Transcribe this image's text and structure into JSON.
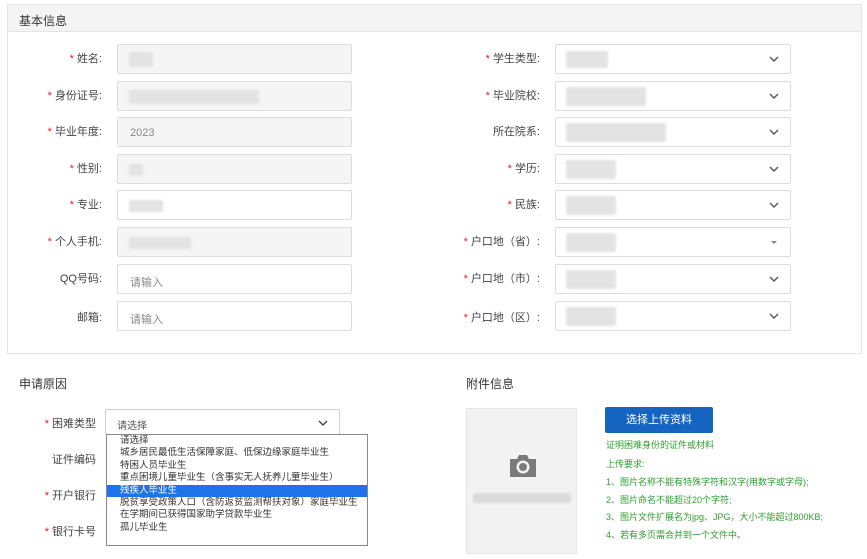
{
  "basic": {
    "title": "基本信息",
    "left_fields": [
      {
        "label": "姓名:",
        "required": true,
        "value": "",
        "placeholder": "",
        "disabled": true
      },
      {
        "label": "身份证号:",
        "required": true,
        "value": "",
        "placeholder": "",
        "disabled": true
      },
      {
        "label": "毕业年度:",
        "required": true,
        "value": "2023",
        "placeholder": "",
        "disabled": true
      },
      {
        "label": "性别:",
        "required": true,
        "value": "",
        "placeholder": "",
        "disabled": true
      },
      {
        "label": "专业:",
        "required": true,
        "value": "",
        "placeholder": "",
        "disabled": false
      },
      {
        "label": "个人手机:",
        "required": true,
        "value": "",
        "placeholder": "",
        "disabled": true
      },
      {
        "label": "QQ号码:",
        "required": false,
        "value": "",
        "placeholder": "请输入",
        "disabled": false
      },
      {
        "label": "邮箱:",
        "required": false,
        "value": "",
        "placeholder": "请输入",
        "disabled": false
      }
    ],
    "right_fields": [
      {
        "label": "学生类型:",
        "required": true
      },
      {
        "label": "毕业院校:",
        "required": true
      },
      {
        "label": "所在院系:",
        "required": false
      },
      {
        "label": "学历:",
        "required": true
      },
      {
        "label": "民族:",
        "required": true
      },
      {
        "label": "户口地（省）:",
        "required": true
      },
      {
        "label": "户口地（市）:",
        "required": true
      },
      {
        "label": "户口地（区）:",
        "required": true
      }
    ]
  },
  "apply": {
    "title": "申请原因",
    "difficulty_label": "困难类型",
    "difficulty_value": "请选择",
    "cert_label": "证件编码",
    "bank_label": "开户银行",
    "card_label": "银行卡号",
    "options": [
      "请选择",
      "城乡居民最低生活保障家庭、低保边缘家庭毕业生",
      "特困人员毕业生",
      "重点困境儿童毕业生（含事实无人抚养儿童毕业生）",
      "残疾人毕业生",
      "脱贫享受政策人口（含防返贫监测帮扶对象）家庭毕业生",
      "在学期间已获得国家助学贷款毕业生",
      "孤儿毕业生"
    ],
    "active_option": 4
  },
  "attachment": {
    "title": "附件信息",
    "upload_button": "选择上传资料",
    "hint": "证明困难身份的证件或材料",
    "req_title": "上传要求:",
    "rules": [
      "1、图片名称不能有特殊字符和汉字(用数字或字母);",
      "2、图片命名不能超过20个字符;",
      "3、图片文件扩展名为jpg、JPG，大小不能超过800KB;",
      "4、若有多页需合并到一个文件中。"
    ]
  },
  "colors": {
    "accent": "#1565c0",
    "required": "#e02020",
    "hint": "#2e9e2e",
    "active_option": "#1e73e8"
  }
}
